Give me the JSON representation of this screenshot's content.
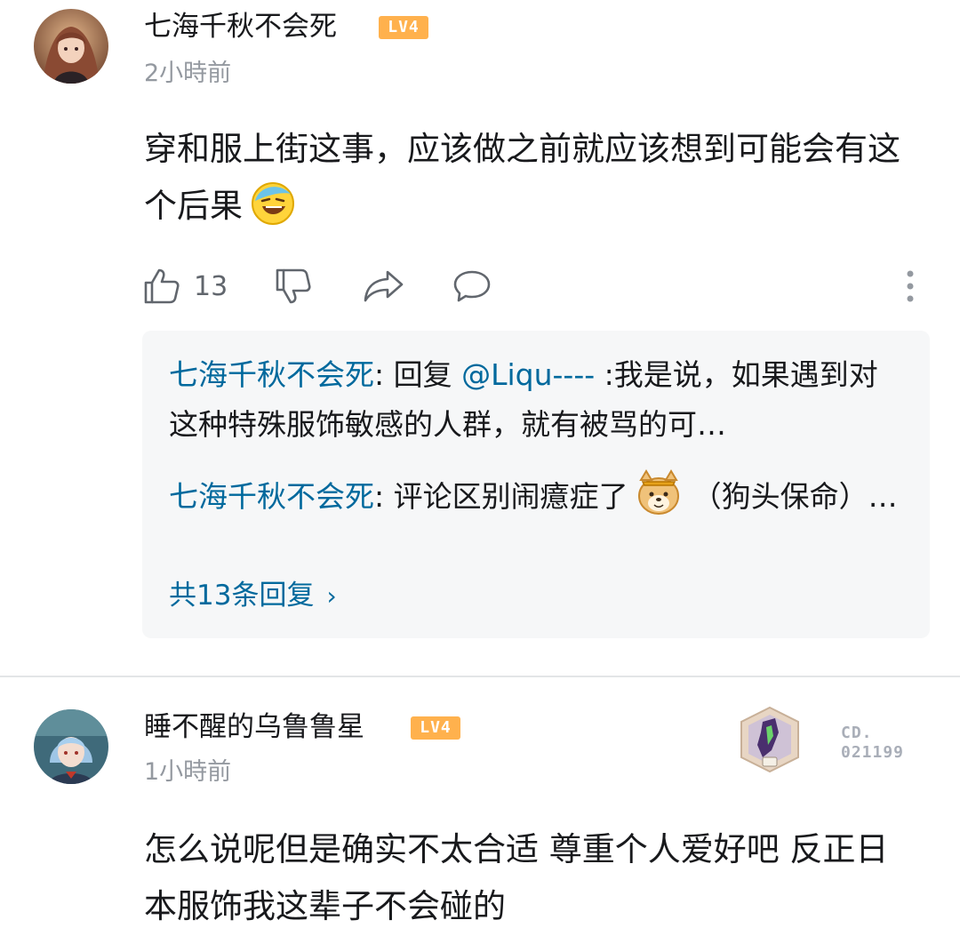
{
  "comments": [
    {
      "username": "七海千秋不会死",
      "level": "LV4",
      "time": "2小時前",
      "content": "穿和服上街这事，应该做之前就应该想到可能会有这个后果",
      "likes": "13",
      "replies": [
        {
          "name": "七海千秋不会死",
          "sep": ": ",
          "prefix": "回复 ",
          "mention": "@Liqu----",
          "text": " :我是说，如果遇到对这种特殊服饰敏感的人群，就有被骂的可…"
        },
        {
          "name": "七海千秋不会死",
          "sep": ": ",
          "text_before": "评论区别闹癔症了",
          "text_after": "（狗头保命）…"
        }
      ],
      "reply_total": "共13条回复",
      "reply_chevron": "›"
    },
    {
      "username": "睡不醒的乌鲁鲁星",
      "level": "LV4",
      "time": "1小時前",
      "content": "怎么说呢但是确实不太合适  尊重个人爱好吧  反正日本服饰我这辈子不会碰的",
      "badge_line1": "CD.",
      "badge_line2": "021199"
    }
  ],
  "icons": {
    "like": "thumb-up-icon",
    "dislike": "thumb-down-icon",
    "share": "share-icon",
    "reply": "comment-bubble-icon",
    "more": "more-vertical-icon"
  },
  "colors": {
    "link": "#00699d",
    "level_badge": "#ffb14d",
    "meta_text": "#9499a0",
    "reply_bg": "#f6f7f8"
  }
}
